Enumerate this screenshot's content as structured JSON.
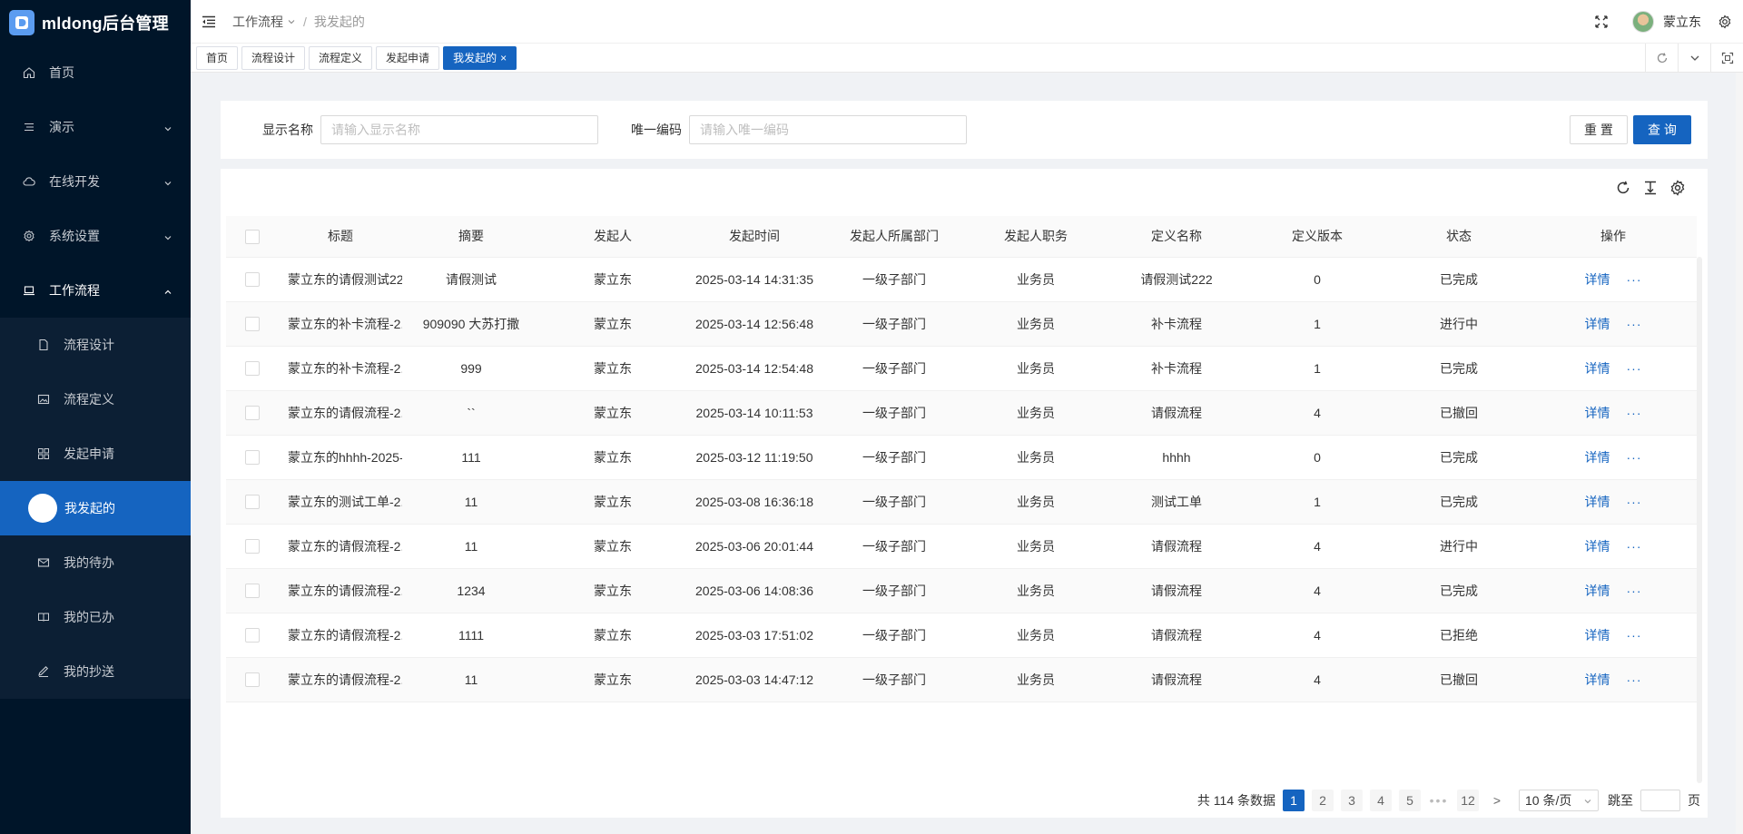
{
  "app": {
    "title": "mldong后台管理"
  },
  "sidebar": {
    "items": [
      {
        "label": "首页",
        "icon": "home-icon"
      },
      {
        "label": "演示",
        "icon": "list-icon"
      },
      {
        "label": "在线开发",
        "icon": "cloud-icon"
      },
      {
        "label": "系统设置",
        "icon": "gear-icon"
      },
      {
        "label": "工作流程",
        "icon": "laptop-icon"
      }
    ],
    "workflow_children": [
      {
        "label": "流程设计",
        "icon": "file-icon"
      },
      {
        "label": "流程定义",
        "icon": "image-icon"
      },
      {
        "label": "发起申请",
        "icon": "grid-icon"
      },
      {
        "label": "我发起的",
        "icon": "dot-icon"
      },
      {
        "label": "我的待办",
        "icon": "mail-icon"
      },
      {
        "label": "我的已办",
        "icon": "book-icon"
      },
      {
        "label": "我的抄送",
        "icon": "pen-icon"
      }
    ]
  },
  "header": {
    "breadcrumb": [
      "工作流程",
      "我发起的"
    ],
    "breadcrumb_sep": "/",
    "username": "蒙立东"
  },
  "tabs": [
    "首页",
    "流程设计",
    "流程定义",
    "发起申请",
    "我发起的"
  ],
  "tab_close": "×",
  "search": {
    "name_label": "显示名称",
    "name_placeholder": "请输入显示名称",
    "code_label": "唯一编码",
    "code_placeholder": "请输入唯一编码",
    "reset": "重 置",
    "query": "查 询"
  },
  "table": {
    "columns": [
      "标题",
      "摘要",
      "发起人",
      "发起时间",
      "发起人所属部门",
      "发起人职务",
      "定义名称",
      "定义版本",
      "状态",
      "操作"
    ],
    "detail_label": "详情",
    "more_label": "···",
    "rows": [
      [
        "蒙立东的请假测试22...",
        "请假测试",
        "蒙立东",
        "2025-03-14 14:31:35",
        "一级子部门",
        "业务员",
        "请假测试222",
        "0",
        "已完成"
      ],
      [
        "蒙立东的补卡流程-2...",
        "909090 大苏打撒",
        "蒙立东",
        "2025-03-14 12:56:48",
        "一级子部门",
        "业务员",
        "补卡流程",
        "1",
        "进行中"
      ],
      [
        "蒙立东的补卡流程-2...",
        "999",
        "蒙立东",
        "2025-03-14 12:54:48",
        "一级子部门",
        "业务员",
        "补卡流程",
        "1",
        "已完成"
      ],
      [
        "蒙立东的请假流程-2...",
        "``",
        "蒙立东",
        "2025-03-14 10:11:53",
        "一级子部门",
        "业务员",
        "请假流程",
        "4",
        "已撤回"
      ],
      [
        "蒙立东的hhhh-2025-...",
        "111",
        "蒙立东",
        "2025-03-12 11:19:50",
        "一级子部门",
        "业务员",
        "hhhh",
        "0",
        "已完成"
      ],
      [
        "蒙立东的测试工单-2...",
        "11",
        "蒙立东",
        "2025-03-08 16:36:18",
        "一级子部门",
        "业务员",
        "测试工单",
        "1",
        "已完成"
      ],
      [
        "蒙立东的请假流程-2...",
        "11",
        "蒙立东",
        "2025-03-06 20:01:44",
        "一级子部门",
        "业务员",
        "请假流程",
        "4",
        "进行中"
      ],
      [
        "蒙立东的请假流程-2...",
        "1234",
        "蒙立东",
        "2025-03-06 14:08:36",
        "一级子部门",
        "业务员",
        "请假流程",
        "4",
        "已完成"
      ],
      [
        "蒙立东的请假流程-2...",
        "1111",
        "蒙立东",
        "2025-03-03 17:51:02",
        "一级子部门",
        "业务员",
        "请假流程",
        "4",
        "已拒绝"
      ],
      [
        "蒙立东的请假流程-2...",
        "11",
        "蒙立东",
        "2025-03-03 14:47:12",
        "一级子部门",
        "业务员",
        "请假流程",
        "4",
        "已撤回"
      ]
    ]
  },
  "pagination": {
    "total_text": "共 114 条数据",
    "pages": [
      "1",
      "2",
      "3",
      "4",
      "5"
    ],
    "ellipsis": "•••",
    "last_page": "12",
    "next": ">",
    "page_size": "10 条/页",
    "jump_label": "跳至",
    "page_unit": "页"
  },
  "colors": {
    "sidebar_bg": "#001529",
    "primary": "#1564c0"
  }
}
